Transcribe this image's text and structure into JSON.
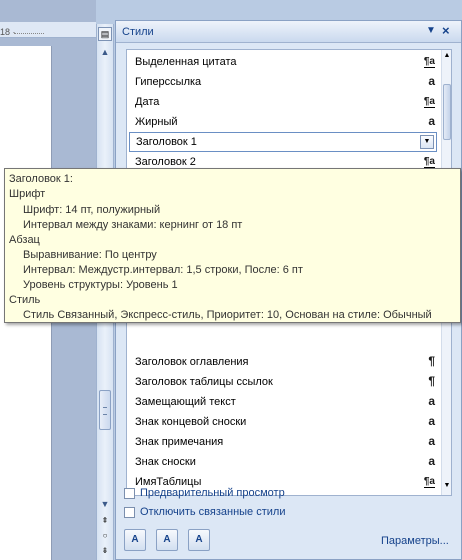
{
  "ruler": {
    "number": "18 ·"
  },
  "pane": {
    "title": "Стили",
    "menu_icon": "dropdown-arrow-icon",
    "close_icon": "close-icon"
  },
  "styles_list": {
    "items": [
      {
        "label": "Выделенная цитата",
        "marker": "¶a"
      },
      {
        "label": "Гиперссылка",
        "marker": "a"
      },
      {
        "label": "Дата",
        "marker": "¶a"
      },
      {
        "label": "Жирный",
        "marker": "a"
      },
      {
        "label": "Заголовок 1",
        "marker": ""
      },
      {
        "label": "Заголовок 2",
        "marker": "¶a"
      },
      {
        "label": "Заголовок оглавления",
        "marker": "¶"
      },
      {
        "label": "Заголовок таблицы ссылок",
        "marker": "¶"
      },
      {
        "label": "Замещающий текст",
        "marker": "a"
      },
      {
        "label": "Знак концевой сноски",
        "marker": "a"
      },
      {
        "label": "Знак примечания",
        "marker": "a"
      },
      {
        "label": "Знак сноски",
        "marker": "a"
      },
      {
        "label": "ИмяТаблицы",
        "marker": "¶a"
      }
    ],
    "selected_index": 4
  },
  "tooltip": {
    "heading": "Заголовок 1:",
    "font_section": "Шрифт",
    "font_line": "Шрифт:  14 пт, полужирный",
    "spacing_line": "Интервал между знаками:  кернинг от 18 пт",
    "paragraph_section": "Абзац",
    "align_line": "Выравнивание:  По центру",
    "interval_line": "Интервал:  Междустр.интервал:  1,5 строки, После:  6 пт",
    "level_line": "Уровень структуры:  Уровень 1",
    "style_section": "Стиль",
    "style_line": "Стиль Связанный, Экспресс-стиль, Приоритет: 10, Основан на стиле: Обычный"
  },
  "options": {
    "preview_label": "Предварительный просмотр",
    "linked_label": "Отключить связанные стили"
  },
  "buttons": {
    "new_style": "A",
    "style_inspector": "A",
    "manage_styles": "A",
    "params_label": "Параметры..."
  }
}
